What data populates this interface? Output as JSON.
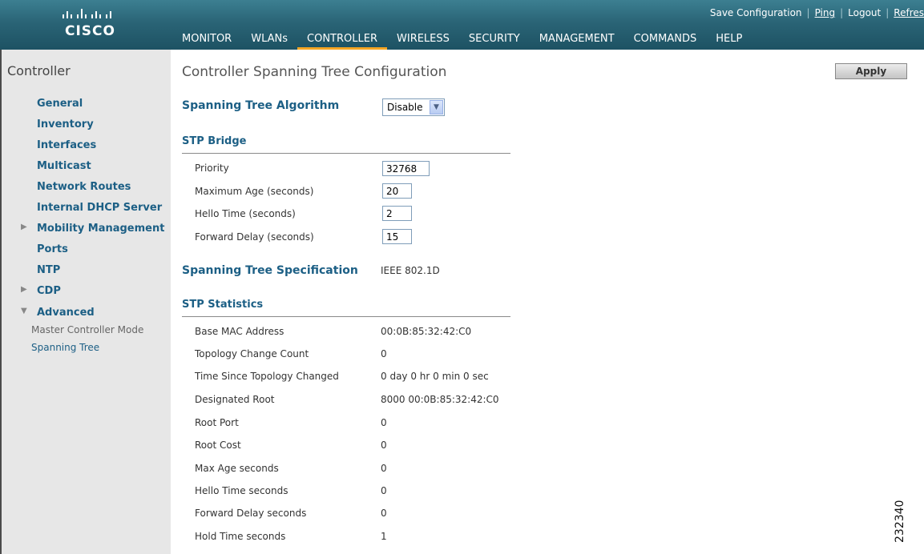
{
  "brand": {
    "logo_text": "CISCO"
  },
  "top_links": [
    "Save Configuration",
    "Ping",
    "Logout",
    "Refres"
  ],
  "nav": [
    "MONITOR",
    "WLANs",
    "CONTROLLER",
    "WIRELESS",
    "SECURITY",
    "MANAGEMENT",
    "COMMANDS",
    "HELP"
  ],
  "nav_active": "CONTROLLER",
  "sidebar": {
    "title": "Controller",
    "items": [
      "General",
      "Inventory",
      "Interfaces",
      "Multicast",
      "Network Routes",
      "Internal DHCP Server",
      "Mobility Management",
      "Ports",
      "NTP",
      "CDP",
      "Advanced"
    ],
    "sub_items": [
      "Master Controller Mode",
      "Spanning Tree"
    ]
  },
  "page": {
    "title": "Controller Spanning Tree Configuration",
    "apply_label": "Apply"
  },
  "stp_algorithm": {
    "label": "Spanning Tree Algorithm",
    "value": "Disable"
  },
  "stp_bridge": {
    "heading": "STP Bridge",
    "fields": [
      {
        "label": "Priority",
        "value": "32768"
      },
      {
        "label": "Maximum Age (seconds)",
        "value": "20"
      },
      {
        "label": "Hello Time (seconds)",
        "value": "2"
      },
      {
        "label": "Forward Delay (seconds)",
        "value": "15"
      }
    ]
  },
  "stp_spec": {
    "label": "Spanning Tree Specification",
    "value": "IEEE 802.1D"
  },
  "stp_stats": {
    "heading": "STP Statistics",
    "rows": [
      {
        "label": "Base MAC Address",
        "value": "00:0B:85:32:42:C0"
      },
      {
        "label": "Topology Change Count",
        "value": "0"
      },
      {
        "label": "Time Since Topology Changed",
        "value": "0 day 0 hr 0 min 0 sec"
      },
      {
        "label": "Designated Root",
        "value": "8000 00:0B:85:32:42:C0"
      },
      {
        "label": "Root Port",
        "value": "0"
      },
      {
        "label": "Root Cost",
        "value": "0"
      },
      {
        "label": "Max Age seconds",
        "value": "0"
      },
      {
        "label": "Hello Time seconds",
        "value": "0"
      },
      {
        "label": "Forward Delay seconds",
        "value": "0"
      },
      {
        "label": "Hold Time seconds",
        "value": "1"
      }
    ]
  },
  "figure_number": "232340",
  "colors": {
    "topbar": "#2a6476",
    "accent": "#f5a623",
    "link": "#1c5f85",
    "sidebar_bg": "#e7e7e7"
  }
}
